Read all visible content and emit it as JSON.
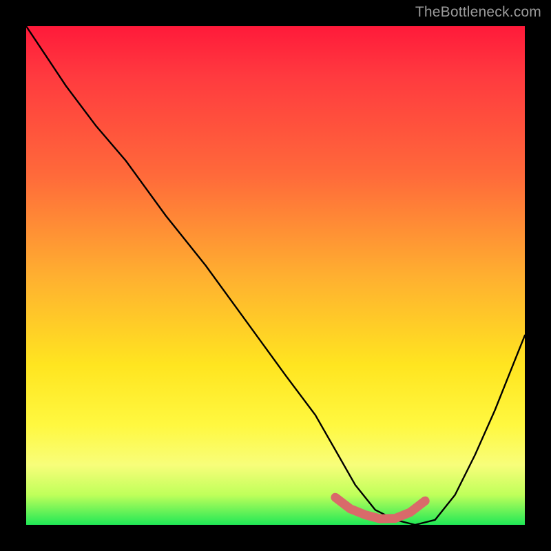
{
  "watermark": "TheBottleneck.com",
  "colors": {
    "background": "#000000",
    "gradient_top": "#ff1a3a",
    "gradient_mid1": "#ff6a3a",
    "gradient_mid2": "#ffe520",
    "gradient_bottom": "#20e856",
    "curve_stroke": "#000000",
    "marker_fill": "#d96a6a"
  },
  "chart_data": {
    "type": "line",
    "title": "",
    "xlabel": "",
    "ylabel": "",
    "xlim": [
      0,
      100
    ],
    "ylim": [
      0,
      100
    ],
    "series": [
      {
        "name": "bottleneck-curve",
        "x": [
          0,
          4,
          8,
          14,
          20,
          28,
          36,
          44,
          52,
          58,
          62,
          66,
          70,
          74,
          78,
          82,
          86,
          90,
          94,
          98,
          100
        ],
        "values": [
          100,
          94,
          88,
          80,
          73,
          62,
          52,
          41,
          30,
          22,
          15,
          8,
          3,
          1,
          0,
          1,
          6,
          14,
          23,
          33,
          38
        ]
      }
    ],
    "markers": {
      "name": "highlight-band",
      "x": [
        62,
        65,
        68,
        71,
        74,
        77,
        80
      ],
      "values": [
        5.5,
        3.2,
        2.0,
        1.2,
        1.3,
        2.5,
        4.8
      ]
    }
  }
}
